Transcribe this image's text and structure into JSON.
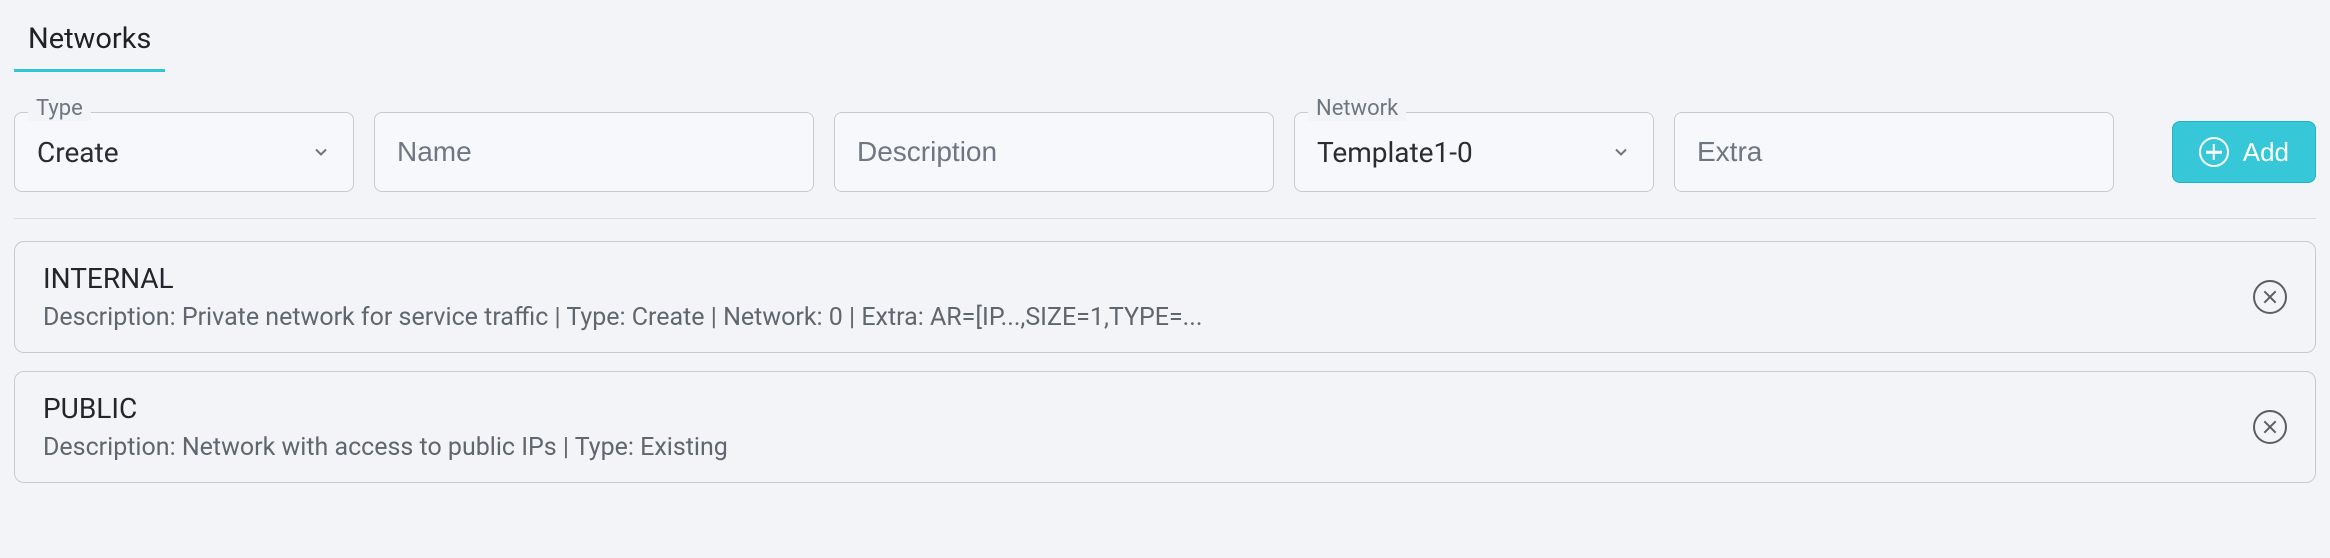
{
  "tabs": {
    "active": "Networks"
  },
  "form": {
    "type": {
      "label": "Type",
      "value": "Create"
    },
    "name": {
      "placeholder": "Name"
    },
    "description": {
      "placeholder": "Description"
    },
    "network": {
      "label": "Network",
      "value": "Template1-0"
    },
    "extra": {
      "placeholder": "Extra"
    },
    "add_label": "Add"
  },
  "items": [
    {
      "title": "INTERNAL",
      "desc": "Description: Private network for service traffic | Type: Create | Network: 0 | Extra: AR=[IP...,SIZE=1,TYPE=..."
    },
    {
      "title": "PUBLIC",
      "desc": "Description: Network with access to public IPs | Type: Existing"
    }
  ]
}
